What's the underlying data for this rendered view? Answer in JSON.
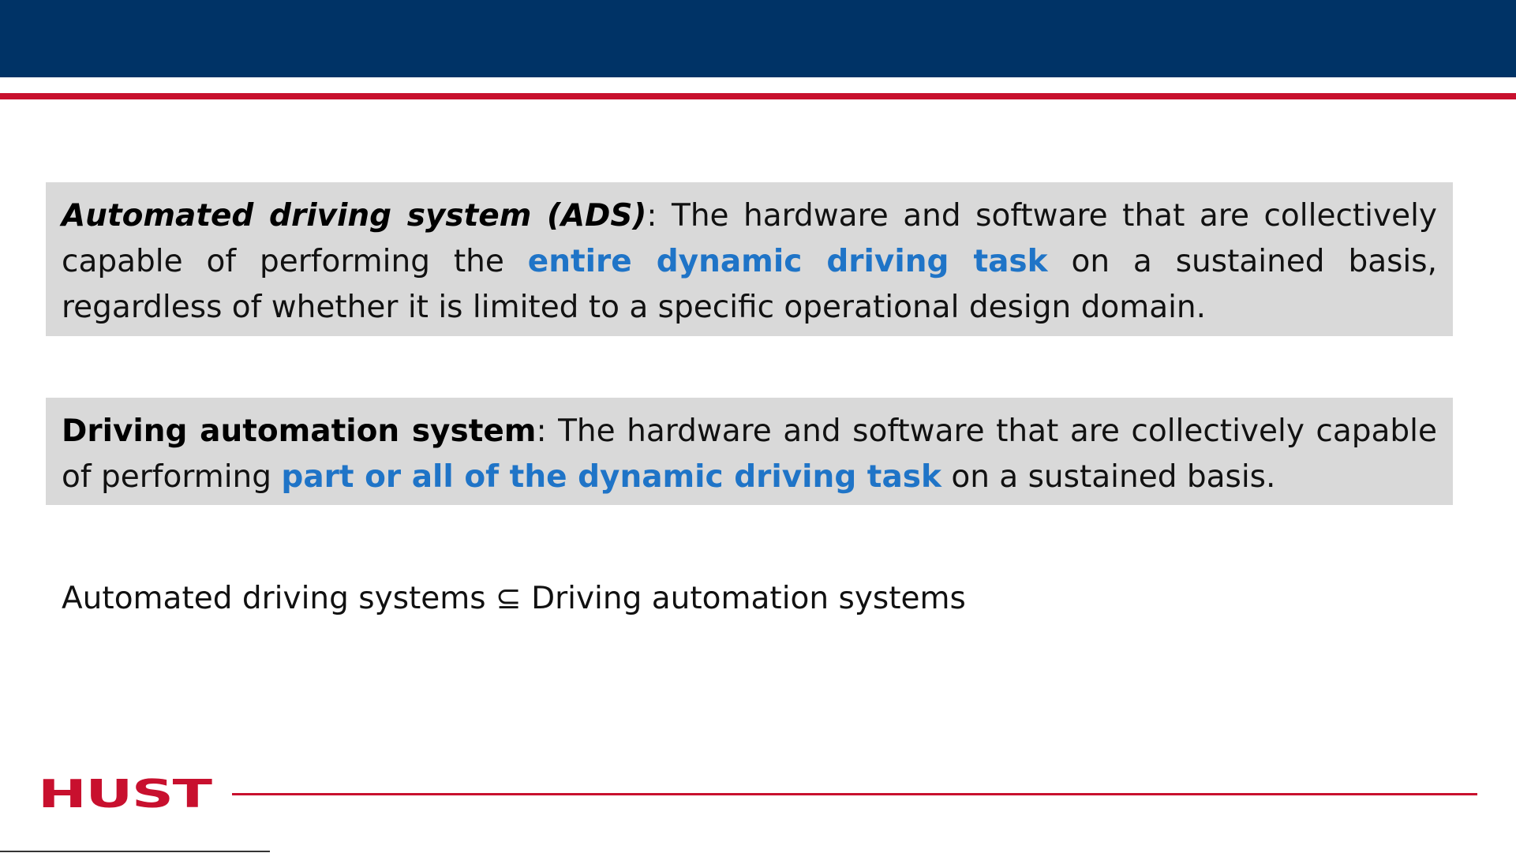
{
  "colors": {
    "header_bar": "#003366",
    "accent_red": "#c8102e",
    "box_bg": "#d9d9d9",
    "highlight_blue": "#1f74c7"
  },
  "definition_ads": {
    "term": "Automated driving system (ADS)",
    "separator": ":",
    "text_before": " The hardware and software that are collectively capable of performing the ",
    "highlight": "entire dynamic driving task",
    "text_after": " on a sustained basis, regardless of whether it is limited to a specific operational design domain."
  },
  "definition_das": {
    "term": "Driving automation system",
    "separator": ":",
    "text_before": " The hardware and software that are collectively capable of performing ",
    "highlight": "part or all of the dynamic driving task",
    "text_after": " on a sustained basis."
  },
  "relation": "Automated driving systems ⊆ Driving automation systems",
  "logo": {
    "text": "HUST"
  }
}
